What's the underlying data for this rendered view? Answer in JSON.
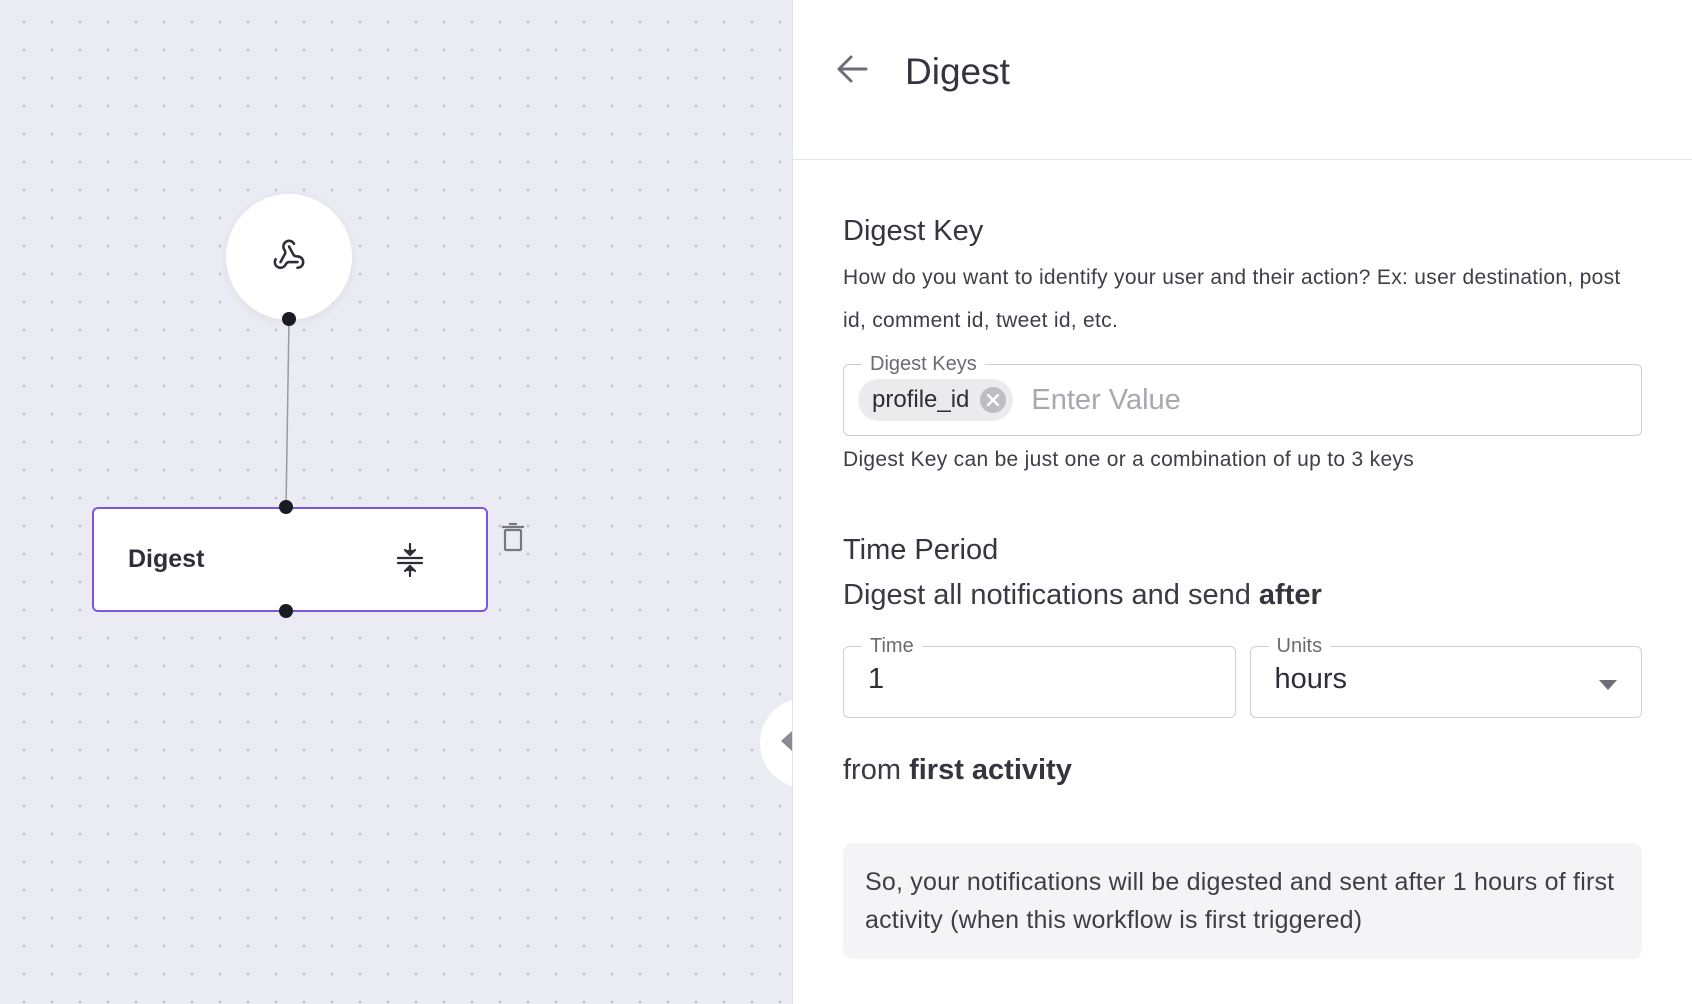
{
  "canvas": {
    "webhook_node_icon": "webhook-icon",
    "digest_node": {
      "label": "Digest",
      "icon": "compress-icon"
    },
    "delete_icon": "trash-icon",
    "resize_handle_icon": "split-arrows-icon"
  },
  "panel": {
    "title": "Digest",
    "back_icon": "arrow-left-icon",
    "digest_key": {
      "title": "Digest Key",
      "description": "How do you want to identify your user and their action? Ex: user destination, post id, comment id, tweet id, etc.",
      "field_label": "Digest Keys",
      "chips": [
        "profile_id"
      ],
      "placeholder": "Enter Value",
      "helper": "Digest Key can be just one or a combination of up to 3 keys"
    },
    "time_period": {
      "title": "Time Period",
      "intro_prefix": "Digest all notifications and send ",
      "intro_bold": "after",
      "time_label": "Time",
      "time_value": "1",
      "units_label": "Units",
      "units_value": "hours",
      "from_prefix": "from ",
      "from_bold": "first activity",
      "summary": "So, your notifications will be digested and sent after 1 hours of first activity (when this workflow is first triggered)"
    }
  },
  "colors": {
    "accent": "#7f55e0",
    "canvas_bg": "#ebebf4",
    "handle": "#1b1b24"
  }
}
